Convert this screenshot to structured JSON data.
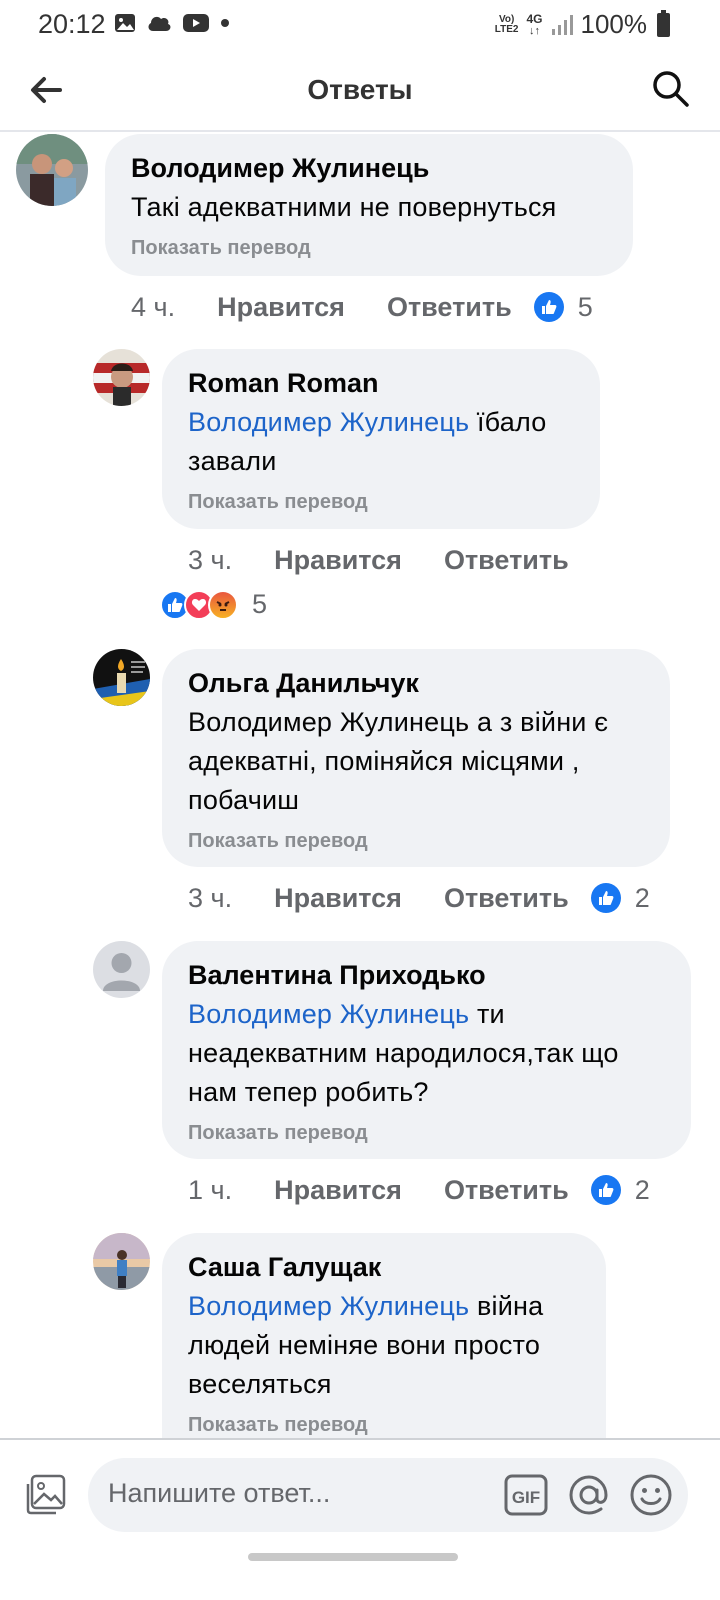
{
  "status_bar": {
    "time": "20:12",
    "network_top": "Vo)",
    "network_bottom": "LTE2",
    "network_type": "4G",
    "battery": "100%"
  },
  "header": {
    "title": "Ответы"
  },
  "comments": [
    {
      "author": "Володимер Жулинець",
      "mention": "",
      "text": "Такі адекватними не повернуться",
      "translate": "Показать перевод",
      "time": "4 ч.",
      "like_label": "Нравится",
      "reply_label": "Ответить",
      "reactions": "5"
    },
    {
      "author": "Roman Roman",
      "mention": "Володимер Жулинець",
      "text": " їбало завали",
      "translate": "Показать перевод",
      "time": "3 ч.",
      "like_label": "Нравится",
      "reply_label": "Ответить",
      "reactions": "5"
    },
    {
      "author": "Ольга Данильчук",
      "mention": "",
      "text": "Володимер Жулинець а з війни є адекватні, поміняйся місцями , побачиш",
      "translate": "Показать перевод",
      "time": "3 ч.",
      "like_label": "Нравится",
      "reply_label": "Ответить",
      "reactions": "2"
    },
    {
      "author": "Валентина Приходько",
      "mention": "Володимер Жулинець",
      "text": " ти неадекватним народилося,так що нам тепер робить?",
      "translate": "Показать перевод",
      "time": "1 ч.",
      "like_label": "Нравится",
      "reply_label": "Ответить",
      "reactions": "2"
    },
    {
      "author": "Саша Галущак",
      "mention": "Володимер Жулинець",
      "text": " війна людей неміняе вони просто веселяться",
      "translate": "Показать перевод"
    }
  ],
  "composer": {
    "placeholder": "Напишите ответ...",
    "gif_label": "GIF"
  },
  "colors": {
    "mention": "#1d64c9",
    "like_blue": "#1877f2",
    "bubble": "#f0f2f5",
    "secondary_text": "#65676b"
  }
}
